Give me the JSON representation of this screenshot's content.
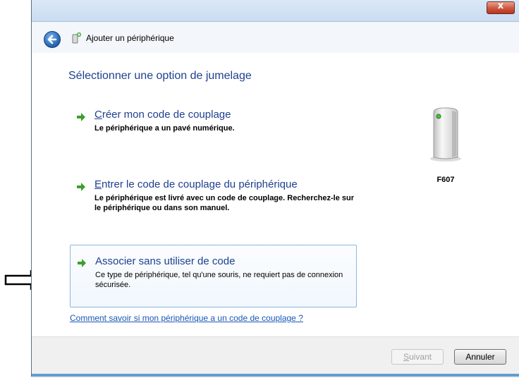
{
  "window": {
    "title": "Ajouter un périphérique",
    "close_label": "x"
  },
  "heading": "Sélectionner une option de jumelage",
  "options": [
    {
      "title_first": "C",
      "title_rest": "réer mon code de couplage",
      "description": "Le périphérique a un pavé numérique."
    },
    {
      "title_first": "E",
      "title_rest": "ntrer le code de couplage du périphérique",
      "description": "Le périphérique est livré avec un code de couplage. Recherchez-le sur le périphérique ou dans son manuel."
    },
    {
      "title_first": "",
      "title_rest": "Associer sans utiliser de code",
      "description": "Ce type de périphérique, tel qu'une souris, ne requiert pas de connexion sécurisée."
    }
  ],
  "device": {
    "name": "F607"
  },
  "help_link": "Comment savoir si mon périphérique a un code de couplage ?",
  "buttons": {
    "next_first": "S",
    "next_rest": "uivant",
    "cancel": "Annuler"
  },
  "colors": {
    "accent_text": "#1e3f8f",
    "link": "#1a56b6",
    "arrow_green": "#3aa02b"
  }
}
